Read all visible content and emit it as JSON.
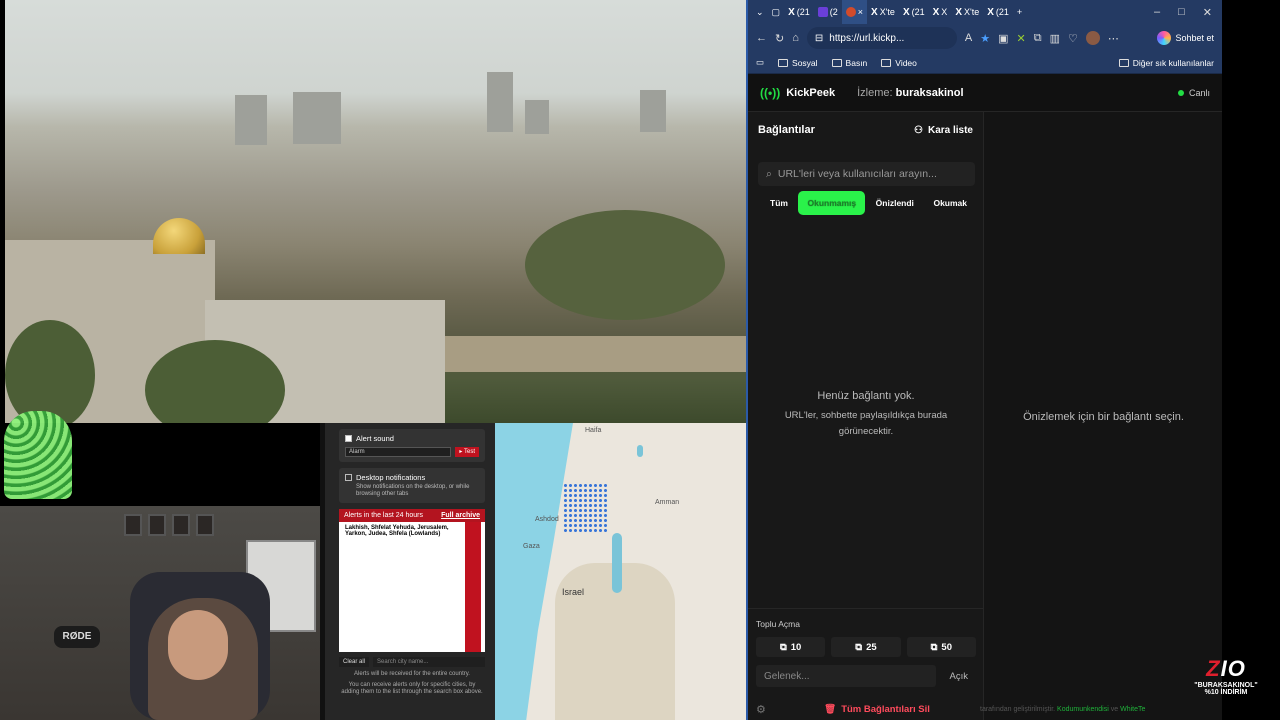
{
  "tabs": [
    {
      "label": "(21"
    },
    {
      "label": "(2"
    },
    {
      "label": "X"
    },
    {
      "label": "X'te"
    },
    {
      "label": "(21"
    },
    {
      "label": "X"
    },
    {
      "label": "X'te"
    },
    {
      "label": "(21"
    }
  ],
  "address": {
    "url": "https://url.kickp...",
    "chat_label": "Sohbet et"
  },
  "favorites": {
    "items": [
      "Sosyal",
      "Basın",
      "Video"
    ],
    "other": "Diğer sık kullanılanlar"
  },
  "app": {
    "name": "KickPeek",
    "watching_label": "İzleme:",
    "channel": "buraksakinol",
    "live_label": "Canlı",
    "panel_title": "Bağlantılar",
    "blacklist_label": "Kara liste",
    "search_placeholder": "URL'leri veya kullanıcıları arayın...",
    "filters": [
      "Tüm",
      "Okunmamış",
      "Önizlendi",
      "Okumak"
    ],
    "empty_title": "Henüz bağlantı yok.",
    "empty_body": "URL'ler, sohbette paylaşıldıkça burada görünecektir.",
    "preview_hint": "Önizlemek için bir bağlantı seçin.",
    "bulk_title": "Toplu Açma",
    "bulk_buttons": [
      "10",
      "25",
      "50"
    ],
    "incoming_placeholder": "Gelenek...",
    "open_label": "Açık",
    "delete_all": "Tüm Bağlantıları Sil",
    "credit_prefix": "tarafından geliştirilmiştir",
    "credit_author1": "Kodumunkendisi",
    "credit_and": "ve",
    "credit_author2": "WhiteTe"
  },
  "alerts": {
    "alert_sound": "Alert sound",
    "sound_option": "Alarm",
    "test": "Test",
    "desktop_notifications": "Desktop notifications",
    "desktop_sub": "Show notifications on the desktop, or while browsing other tabs",
    "last24": "Alerts in the last 24 hours",
    "full_archive": "Full archive",
    "first_alert": "Lakhish, Shfelat Yehuda, Jerusalem, Yarkon, Judea, Shfela (Lowlands)",
    "clear_all": "Clear all",
    "search_placeholder": "Search city name...",
    "note1": "Alerts will be received for the entire country.",
    "note2": "You can receive alerts only for specific cities, by adding them to the list through the search box above."
  },
  "map": {
    "labels": [
      "Haifa",
      "Amman",
      "Ashdod",
      "Gaza",
      "Israel"
    ]
  },
  "promo": {
    "brand": "ZIO",
    "line1": "\"BURAKSAKINOL\"",
    "line2": "%10 İNDİRİM"
  },
  "colors": {
    "accent_green": "#2af24a",
    "danger_red": "#ff4b5c",
    "tab_blue": "#243a63"
  }
}
